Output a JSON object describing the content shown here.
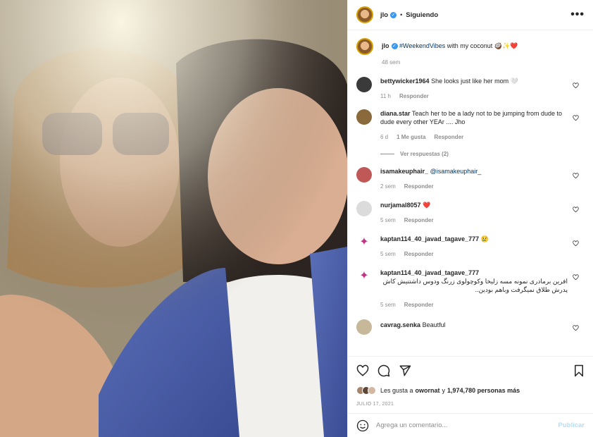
{
  "post": {
    "username": "jlo",
    "follow_state": "Siguiendo",
    "more_label": "•••",
    "caption_user": "jlo",
    "caption_tags": "#WeekendVibes",
    "caption_text": "with my coconut 🥥✨❤️",
    "caption_time": "48 sem"
  },
  "comments": [
    {
      "user": "bettywicker1964",
      "text": "She looks just like her mom 🤍",
      "time": "11 h",
      "likes": "",
      "reply": "Responder"
    },
    {
      "user": "diana.star",
      "text": "Teach her to be a lady not to be jumping from dude to dude every other YEAr .... Jho",
      "time": "6 d",
      "likes": "1 Me gusta",
      "reply": "Responder",
      "view_replies": "Ver respuestas (2)"
    },
    {
      "user": "isamakeuphair_",
      "text": "@isamakeuphair_",
      "time": "2 sem",
      "likes": "",
      "reply": "Responder"
    },
    {
      "user": "nurjamal8057",
      "text": "❤️",
      "time": "5 sem",
      "likes": "",
      "reply": "Responder"
    },
    {
      "user": "kaptan114_40_javad_tagave_777",
      "text": "😢",
      "time": "5 sem",
      "likes": "",
      "reply": "Responder"
    },
    {
      "user": "kaptan114_40_javad_tagave_777",
      "text": "افرین برمادری نمونه مسه زلیخا وکوچولوی زرنگ ودوس داشتنیش کاش پدرش طلاق نمیگرفت وباهم بودین..",
      "time": "5 sem",
      "likes": "",
      "reply": "Responder"
    },
    {
      "user": "cavrag.senka",
      "text": "Beautful",
      "time": "",
      "likes": "",
      "reply": ""
    }
  ],
  "likes": {
    "prefix": "Les gusta a",
    "user": "owornat",
    "suffix": "y",
    "count": "1,974,780 personas más"
  },
  "date": "JULIO 17, 2021",
  "add_comment": {
    "placeholder": "Agrega un comentario...",
    "post_label": "Publicar"
  },
  "colors": {
    "link": "#00376b",
    "muted": "#8e8e8e",
    "post_disabled": "#b2dffc",
    "heart_red": "#ed4956"
  }
}
